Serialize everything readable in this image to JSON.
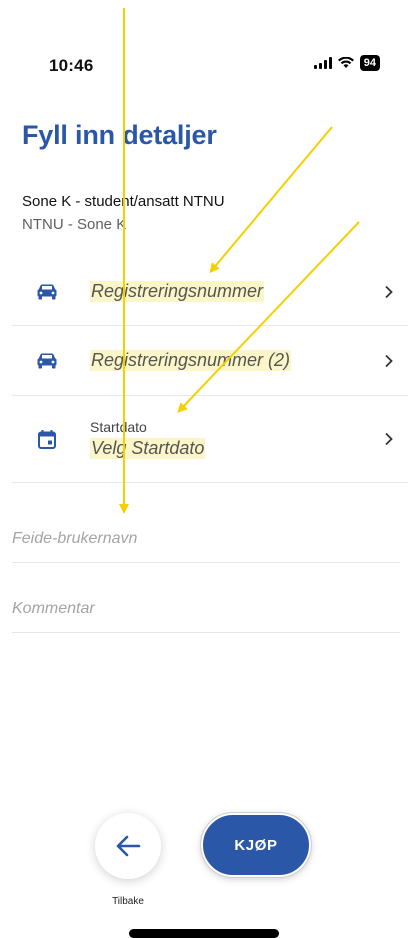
{
  "status_bar": {
    "time": "10:46",
    "battery": "94"
  },
  "page_title": "Fyll inn detaljer",
  "zone": {
    "title": "Sone K - student/ansatt NTNU",
    "subtitle": "NTNU - Sone K"
  },
  "rows": [
    {
      "icon": "car-icon",
      "value": "Registreringsnummer"
    },
    {
      "icon": "car-icon",
      "value": "Registreringsnummer (2)"
    },
    {
      "icon": "calendar-icon",
      "label": "Startdato",
      "value": "Velg Startdato"
    }
  ],
  "fields": {
    "feide_placeholder": "Feide-brukernavn",
    "comment_placeholder": "Kommentar"
  },
  "footer": {
    "back_label": "Tilbake",
    "buy_label": "KJØP"
  },
  "colors": {
    "brand": "#2b57a8",
    "annotation": "#f5d000",
    "highlight": "#fbf6c8"
  }
}
